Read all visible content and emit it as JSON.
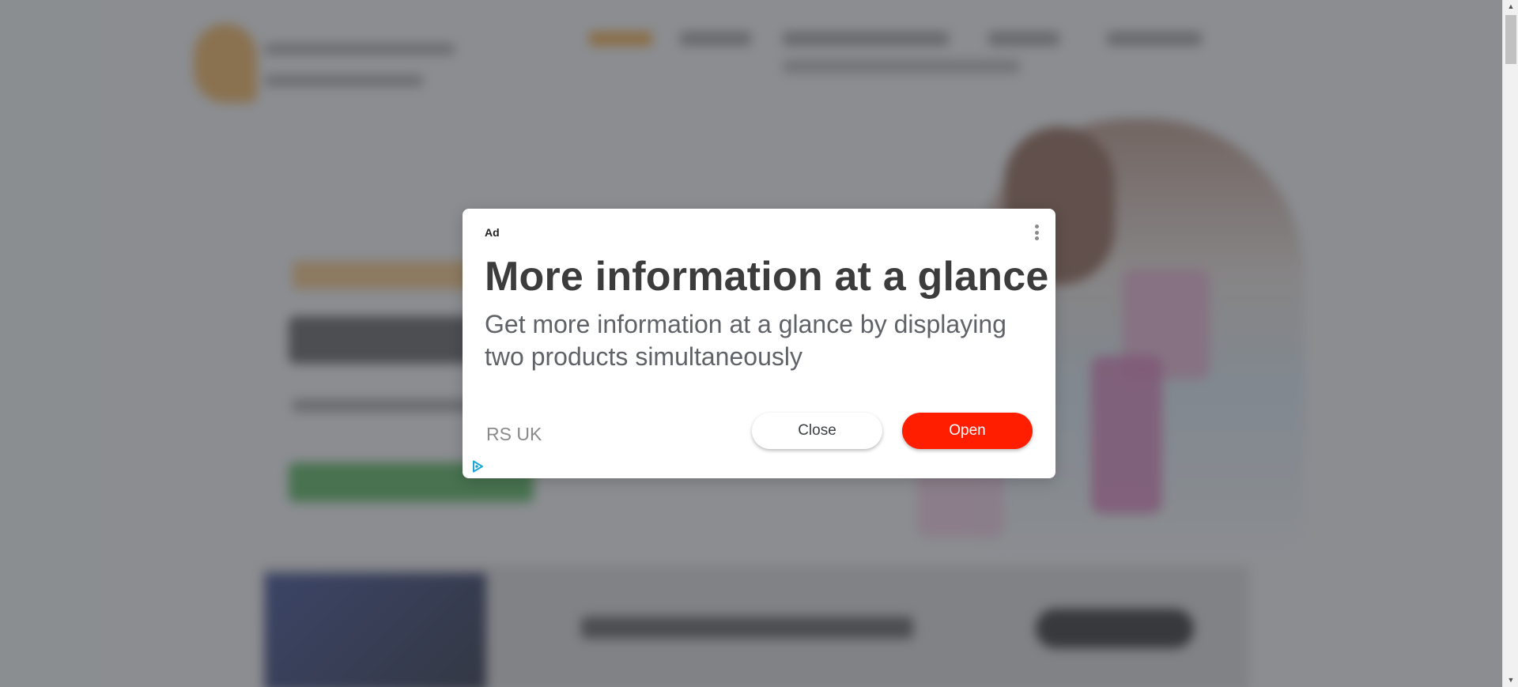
{
  "ad": {
    "label": "Ad",
    "title": "More information at a glance",
    "description": "Get more information at a glance by displaying two products simultaneously",
    "advertiser": "RS UK",
    "close_label": "Close",
    "open_label": "Open",
    "menu_icon": "more-vert-icon",
    "adchoices_icon": "adchoices-icon",
    "colors": {
      "open_button": "#ff1f00",
      "adchoices": "#1ba6d8"
    }
  },
  "scrollbar": {
    "up_icon": "scroll-up-arrow-icon",
    "down_icon": "scroll-down-arrow-icon"
  }
}
